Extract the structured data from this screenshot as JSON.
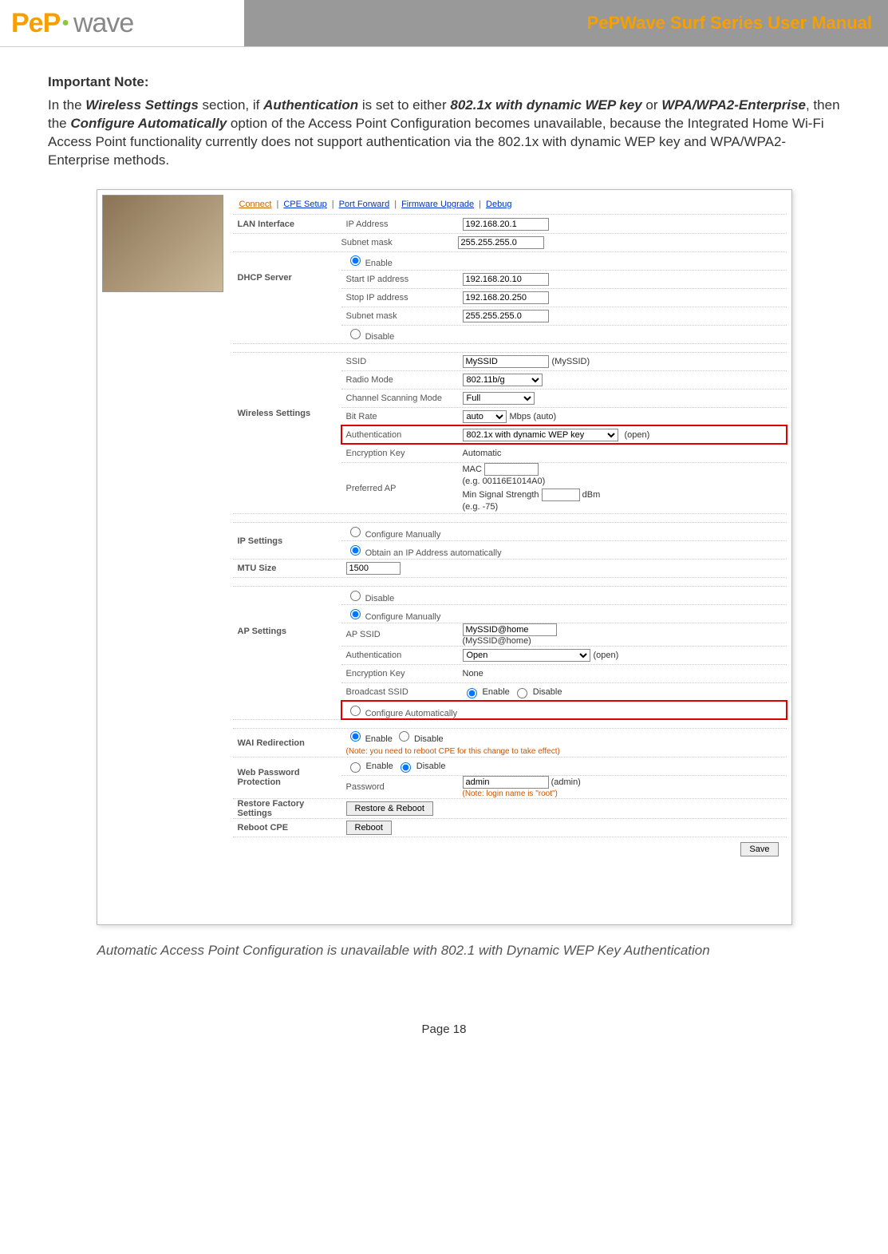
{
  "header": {
    "logo_pep": "PeP",
    "logo_wave": "wave",
    "title": "PePWave Surf Series User Manual"
  },
  "note": {
    "heading": "Important Note:",
    "p1_a": "In the ",
    "p1_b": "Wireless Settings",
    "p1_c": " section, if ",
    "p1_d": "Authentication",
    "p1_e": " is set to either ",
    "p1_f": "802.1x with dynamic WEP key",
    "p1_g": " or ",
    "p1_h": "WPA/WPA2-Enterprise",
    "p1_i": ", then the ",
    "p1_j": "Configure Automatically",
    "p1_k": " option of the Access Point Configuration becomes unavailable, because the Integrated Home Wi-Fi Access Point functionality currently does not support authentication via the 802.1x with dynamic WEP key and WPA/WPA2-Enterprise methods."
  },
  "nav": {
    "connect": "Connect",
    "cpe": "CPE Setup",
    "port": "Port Forward",
    "fw": "Firmware Upgrade",
    "debug": "Debug"
  },
  "sections": {
    "lan": "LAN Interface",
    "dhcp": "DHCP Server",
    "wireless": "Wireless Settings",
    "ip": "IP Settings",
    "mtu": "MTU Size",
    "ap": "AP Settings",
    "wai": "WAI Redirection",
    "web": "Web Password Protection",
    "restore": "Restore Factory Settings",
    "reboot": "Reboot CPE"
  },
  "labels": {
    "ip_address": "IP Address",
    "subnet": "Subnet mask",
    "enable": "Enable",
    "disable": "Disable",
    "start_ip": "Start IP address",
    "stop_ip": "Stop IP address",
    "ssid": "SSID",
    "radio": "Radio Mode",
    "chscan": "Channel Scanning Mode",
    "bitrate": "Bit Rate",
    "auth": "Authentication",
    "enc": "Encryption Key",
    "pref_ap": "Preferred AP",
    "conf_man": "Configure Manually",
    "obtain": "Obtain an IP Address automatically",
    "ap_ssid": "AP SSID",
    "bcast": "Broadcast SSID",
    "conf_auto": "Configure Automatically",
    "password": "Password",
    "restore_btn": "Restore & Reboot",
    "reboot_btn": "Reboot",
    "save_btn": "Save"
  },
  "values": {
    "lan_ip": "192.168.20.1",
    "lan_subnet": "255.255.255.0",
    "dhcp_start": "192.168.20.10",
    "dhcp_stop": "192.168.20.250",
    "dhcp_subnet": "255.255.255.0",
    "ssid": "MySSID",
    "ssid_hint": "(MySSID)",
    "radio": "802.11b/g",
    "chscan": "Full",
    "bitrate": "auto",
    "bitrate_hint": "Mbps (auto)",
    "auth": "802.1x with dynamic WEP key",
    "auth_hint": "(open)",
    "enc": "Automatic",
    "mac_label": "MAC",
    "mac_eg": "(e.g. 00116E1014A0)",
    "min_sig": "Min Signal Strength",
    "dbm": "dBm",
    "min_sig_eg": "(e.g. -75)",
    "mtu": "1500",
    "ap_ssid": "MySSID@home",
    "ap_ssid_hint": "(MySSID@home)",
    "ap_auth": "Open",
    "ap_auth_hint": "(open)",
    "ap_enc": "None",
    "reboot_note": "(Note: you need to reboot CPE for this change to take effect)",
    "pw": "admin",
    "pw_hint": "(admin)",
    "login_note": "(Note: login name is \"root\")"
  },
  "caption": "Automatic Access Point Configuration is unavailable with 802.1 with Dynamic WEP Key Authentication",
  "footer": "Page 18"
}
